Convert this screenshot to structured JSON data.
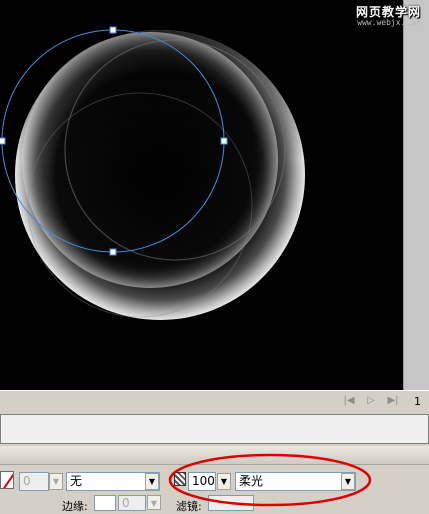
{
  "watermark": {
    "line1": "网页教学网",
    "line2": "www.webjx.com"
  },
  "playback": {
    "buttons": [
      "|◀",
      "▷",
      "▶|"
    ],
    "frame": "1"
  },
  "properties": {
    "stroke_width_value": "0",
    "fill_style_value": "无",
    "opacity_value": "100",
    "blend_mode_value": "柔光",
    "edge_label": "边缘:",
    "edge_value": "0",
    "filter_label": "滤镜:"
  },
  "colors": {
    "stage": "#000000",
    "selection_path": "#3d8fe0",
    "annotation_ellipse": "#dd0000",
    "panel_bg": "#d4d0c8"
  }
}
